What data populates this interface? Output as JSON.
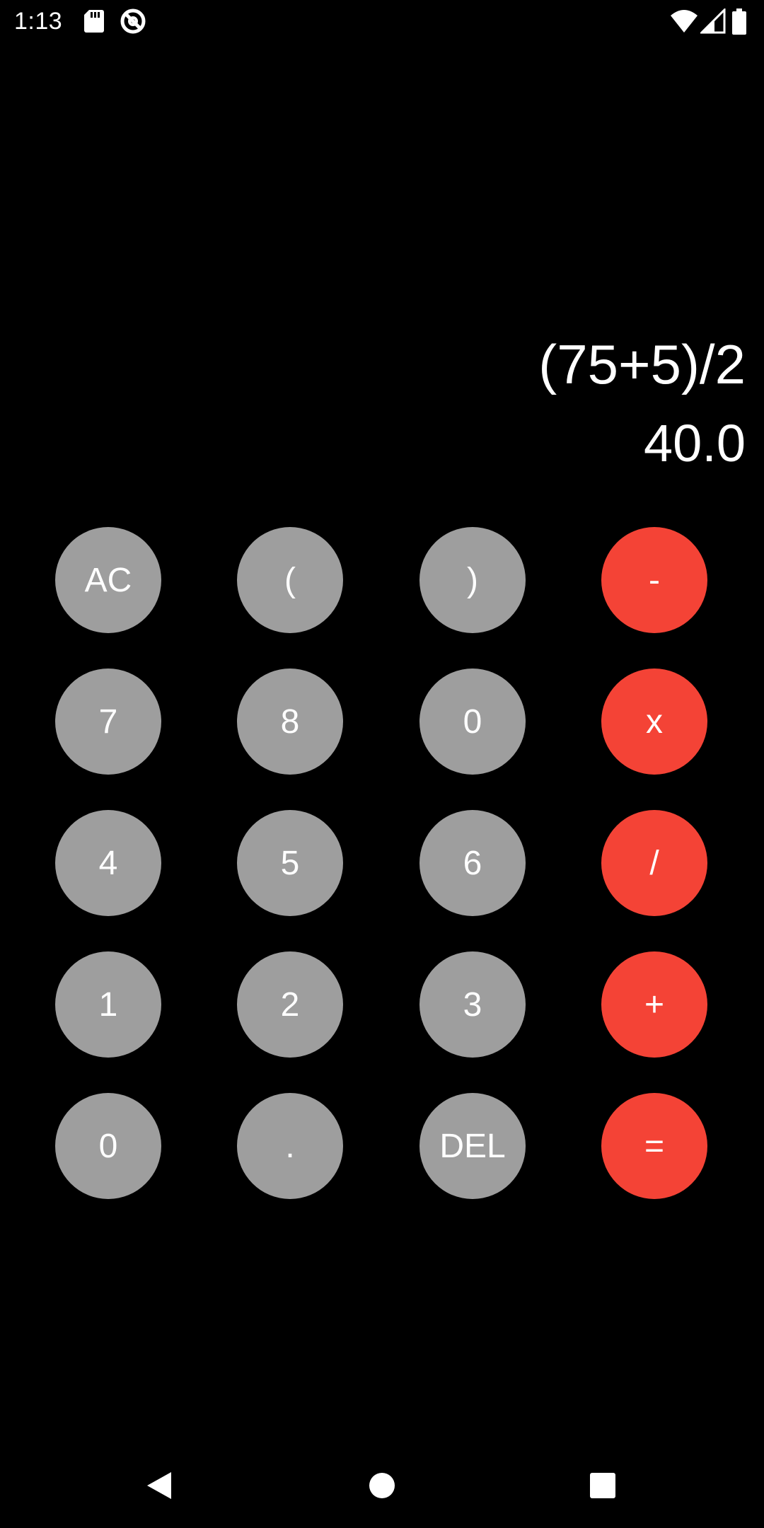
{
  "status_bar": {
    "time": "1:13",
    "icons": [
      "sd-card-icon",
      "sync-icon",
      "wifi-icon",
      "signal-icon",
      "battery-icon"
    ]
  },
  "display": {
    "expression": "(75+5)/2",
    "result": "40.0"
  },
  "colors": {
    "background": "#000000",
    "number_key": "#9e9e9e",
    "operator_key": "#f44336",
    "text": "#ffffff"
  },
  "keys": {
    "row1": [
      "AC",
      "(",
      ")",
      "-"
    ],
    "row2": [
      "7",
      "8",
      "0",
      "x"
    ],
    "row3": [
      "4",
      "5",
      "6",
      "/"
    ],
    "row4": [
      "1",
      "2",
      "3",
      "+"
    ],
    "row5": [
      "0",
      ".",
      "DEL",
      "="
    ]
  },
  "nav_bar": {
    "icons": [
      "back-icon",
      "home-icon",
      "recents-icon"
    ]
  }
}
